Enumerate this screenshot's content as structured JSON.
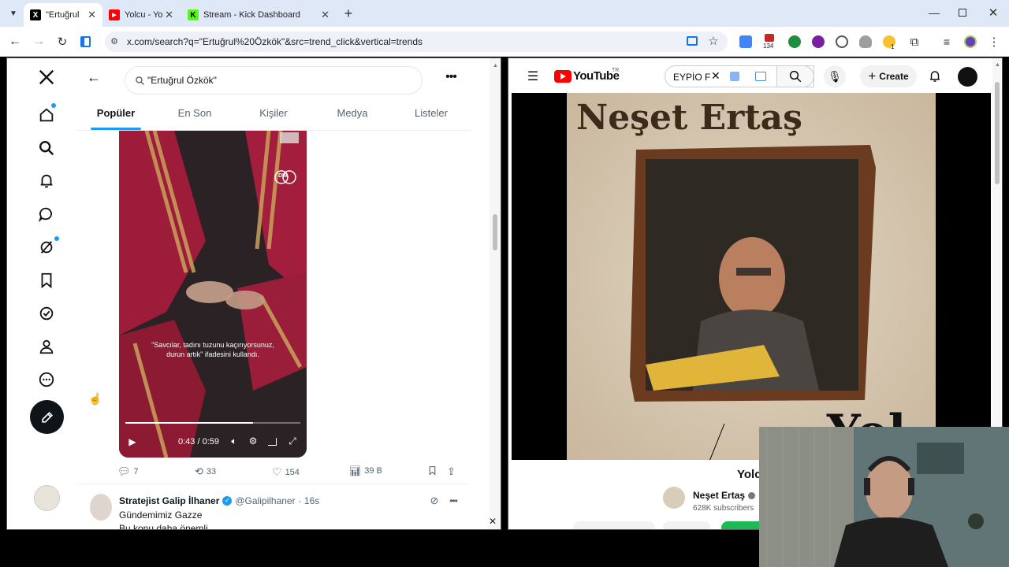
{
  "tabs": [
    {
      "title": "\"Ertuğrul",
      "favicon": "x-logo",
      "active": true
    },
    {
      "title": "Yolcu - Yo",
      "favicon": "youtube-logo",
      "active": false
    },
    {
      "title": "Stream - Kick Dashboard",
      "favicon": "kick-logo",
      "active": false
    }
  ],
  "address": {
    "url": "x.com/search?q=\"Ertuğrul%20Özkök\"&src=trend_click&vertical=trends"
  },
  "extensions": {
    "badge_count": "134",
    "badge_one": "1"
  },
  "x": {
    "search_value": "\"Ertuğrul Özkök\"",
    "tabs": [
      "Popüler",
      "En Son",
      "Kişiler",
      "Medya",
      "Listeler"
    ],
    "video": {
      "watermark": "DW",
      "caption_line1": "\"Savcılar, tadını tuzunu kaçırıyorsunuz,",
      "caption_line2": "durun artık\" ifadesini kullandı.",
      "time": "0:43 / 0:59",
      "progress": 0.73
    },
    "actions": {
      "replies": "7",
      "reposts": "33",
      "likes": "154",
      "views": "39 B"
    },
    "next_post": {
      "name": "Stratejist Galip İlhaner",
      "handle": "@Galipilhaner",
      "time": "· 16s",
      "text": "Gündemimiz Gazze",
      "text2": "Bu konu daha önemli"
    }
  },
  "youtube": {
    "logo_text": "YouTube",
    "region": "TR",
    "search_value": "EYPİO F",
    "create_label": "Create",
    "thumbnail_title": "Neşet Ertaş",
    "thumbnail_partial": "Yol",
    "video_title_partial": "Yolc",
    "channel": "Neşet Ertaş",
    "subscribers": "628K subscribers"
  },
  "colors": {
    "x_blue": "#1d9bf0",
    "yt_red": "#ff0000",
    "kick_green": "#53fc18"
  }
}
